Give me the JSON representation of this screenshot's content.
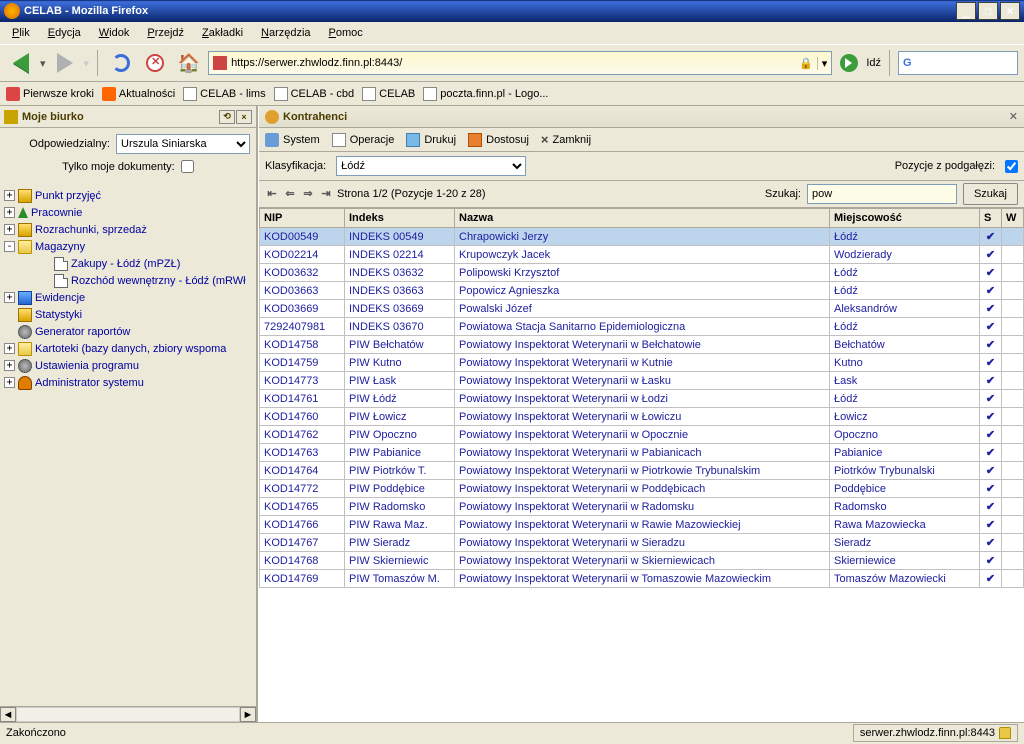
{
  "window": {
    "title": "CELAB - Mozilla Firefox"
  },
  "menubar": [
    "Plik",
    "Edycja",
    "Widok",
    "Przejdź",
    "Zakładki",
    "Narzędzia",
    "Pomoc"
  ],
  "toolbar": {
    "url": "https://serwer.zhwlodz.finn.pl:8443/",
    "go": "Idź"
  },
  "bookmarks": [
    "Pierwsze kroki",
    "Aktualności",
    "CELAB - lims",
    "CELAB - cbd",
    "CELAB",
    "poczta.finn.pl - Logo..."
  ],
  "sidebar": {
    "title": "Moje biurko",
    "resp_label": "Odpowiedzialny:",
    "resp_value": "Urszula Siniarska",
    "onlymy_label": "Tylko moje dokumenty:",
    "tree": [
      {
        "exp": "+",
        "ic": "ic-yel",
        "label": "Punkt przyjęć",
        "i": 0
      },
      {
        "exp": "+",
        "ic": "ic-grn",
        "label": "Pracownie",
        "i": 0,
        "tri": true
      },
      {
        "exp": "+",
        "ic": "ic-yel",
        "label": "Rozrachunki, sprzedaż",
        "i": 0
      },
      {
        "exp": "-",
        "ic": "ic-folder",
        "label": "Magazyny",
        "i": 0
      },
      {
        "exp": "",
        "ic": "ic-doc2",
        "label": "Zakupy - Łódź (mPZŁ)",
        "i": 2
      },
      {
        "exp": "",
        "ic": "ic-doc2",
        "label": "Rozchód wewnętrzny - Łódź (mRWł",
        "i": 2
      },
      {
        "exp": "+",
        "ic": "ic-blue",
        "label": "Ewidencje",
        "i": 0
      },
      {
        "exp": "",
        "ic": "ic-yel",
        "label": "Statystyki",
        "i": 0
      },
      {
        "exp": "",
        "ic": "ic-gear",
        "label": "Generator raportów",
        "i": 0
      },
      {
        "exp": "+",
        "ic": "ic-folder",
        "label": "Kartoteki (bazy danych, zbiory wspoma",
        "i": 0
      },
      {
        "exp": "+",
        "ic": "ic-gear",
        "label": "Ustawienia programu",
        "i": 0
      },
      {
        "exp": "+",
        "ic": "ic-user",
        "label": "Administrator systemu",
        "i": 0
      }
    ]
  },
  "content": {
    "title": "Kontrahenci",
    "menu": {
      "system": "System",
      "operacje": "Operacje",
      "drukuj": "Drukuj",
      "dostosuj": "Dostosuj",
      "zamknij": "Zamknij"
    },
    "filter": {
      "klas_label": "Klasyfikacja:",
      "klas_value": "Łódź",
      "sub_label": "Pozycje z podgałęzi:",
      "nav_text": "Strona 1/2 (Pozycje 1-20 z 28)",
      "search_label": "Szukaj:",
      "search_value": "pow",
      "search_btn": "Szukaj"
    },
    "columns": [
      "NIP",
      "Indeks",
      "Nazwa",
      "Miejscowość",
      "S",
      "W"
    ],
    "rows": [
      {
        "sel": true,
        "nip": "KOD00549",
        "indeks": "INDEKS 00549",
        "nazwa": "Chrapowicki Jerzy",
        "miej": "Łódź"
      },
      {
        "nip": "KOD02214",
        "indeks": "INDEKS 02214",
        "nazwa": "Krupowczyk Jacek",
        "miej": "Wodzierady"
      },
      {
        "nip": "KOD03632",
        "indeks": "INDEKS 03632",
        "nazwa": "Polipowski Krzysztof",
        "miej": "Łódź"
      },
      {
        "nip": "KOD03663",
        "indeks": "INDEKS 03663",
        "nazwa": "Popowicz Agnieszka",
        "miej": "Łódź"
      },
      {
        "nip": "KOD03669",
        "indeks": "INDEKS 03669",
        "nazwa": "Powalski Józef",
        "miej": "Aleksandrów"
      },
      {
        "nip": "7292407981",
        "indeks": "INDEKS 03670",
        "nazwa": "Powiatowa Stacja Sanitarno Epidemiologiczna",
        "miej": "Łódź"
      },
      {
        "nip": "KOD14758",
        "indeks": "PIW Bełchatów",
        "nazwa": "Powiatowy Inspektorat Weterynarii w Bełchatowie",
        "miej": "Bełchatów"
      },
      {
        "nip": "KOD14759",
        "indeks": "PIW Kutno",
        "nazwa": "Powiatowy Inspektorat Weterynarii w Kutnie",
        "miej": "Kutno"
      },
      {
        "nip": "KOD14773",
        "indeks": "PIW Łask",
        "nazwa": "Powiatowy Inspektorat Weterynarii w Łasku",
        "miej": "Łask"
      },
      {
        "nip": "KOD14761",
        "indeks": "PIW Łódź",
        "nazwa": "Powiatowy Inspektorat Weterynarii w Łodzi",
        "miej": "Łódź"
      },
      {
        "nip": "KOD14760",
        "indeks": "PIW Łowicz",
        "nazwa": "Powiatowy Inspektorat Weterynarii w Łowiczu",
        "miej": "Łowicz"
      },
      {
        "nip": "KOD14762",
        "indeks": "PIW Opoczno",
        "nazwa": "Powiatowy Inspektorat Weterynarii w Opocznie",
        "miej": "Opoczno"
      },
      {
        "nip": "KOD14763",
        "indeks": "PIW Pabianice",
        "nazwa": "Powiatowy Inspektorat Weterynarii w Pabianicach",
        "miej": "Pabianice"
      },
      {
        "nip": "KOD14764",
        "indeks": "PIW Piotrków T.",
        "nazwa": "Powiatowy Inspektorat Weterynarii w Piotrkowie Trybunalskim",
        "miej": "Piotrków Trybunalski"
      },
      {
        "nip": "KOD14772",
        "indeks": "PIW Poddębice",
        "nazwa": "Powiatowy Inspektorat Weterynarii w Poddębicach",
        "miej": "Poddębice"
      },
      {
        "nip": "KOD14765",
        "indeks": "PIW Radomsko",
        "nazwa": "Powiatowy Inspektorat Weterynarii w Radomsku",
        "miej": "Radomsko"
      },
      {
        "nip": "KOD14766",
        "indeks": "PIW Rawa Maz.",
        "nazwa": "Powiatowy Inspektorat Weterynarii w Rawie Mazowieckiej",
        "miej": "Rawa Mazowiecka"
      },
      {
        "nip": "KOD14767",
        "indeks": "PIW Sieradz",
        "nazwa": "Powiatowy Inspektorat Weterynarii w Sieradzu",
        "miej": "Sieradz"
      },
      {
        "nip": "KOD14768",
        "indeks": "PIW Skierniewic",
        "nazwa": "Powiatowy Inspektorat Weterynarii w Skierniewicach",
        "miej": "Skierniewice"
      },
      {
        "nip": "KOD14769",
        "indeks": "PIW Tomaszów M.",
        "nazwa": "Powiatowy Inspektorat Weterynarii w Tomaszowie Mazowieckim",
        "miej": "Tomaszów Mazowiecki"
      }
    ]
  },
  "status": {
    "left": "Zakończono",
    "right": "serwer.zhwlodz.finn.pl:8443"
  }
}
